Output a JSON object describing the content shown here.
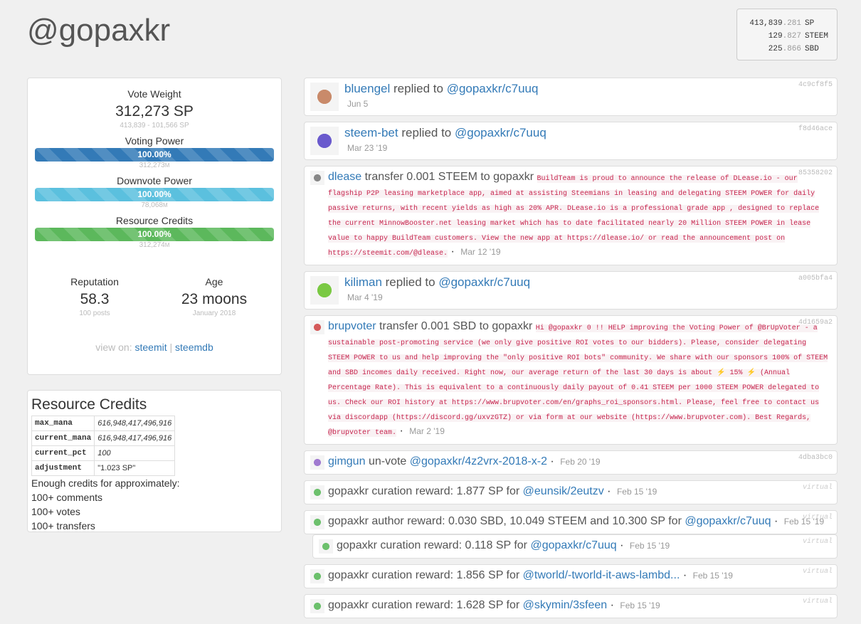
{
  "title": "@gopaxkr",
  "balances": [
    {
      "int": "413,839",
      "dec": ".281",
      "unit": "SP"
    },
    {
      "int": "129",
      "dec": ".827",
      "unit": "STEEM"
    },
    {
      "int": "225",
      "dec": ".866",
      "unit": "SBD"
    }
  ],
  "vote": {
    "label": "Vote Weight",
    "value": "312,273 SP",
    "range": "413,839 - 101,566 SP"
  },
  "bars": [
    {
      "label": "Voting Power",
      "pct": "100.00%",
      "value": 100,
      "sub": "312,273",
      "unit": "M",
      "color": "#337ab7"
    },
    {
      "label": "Downvote Power",
      "pct": "100.00%",
      "value": 100,
      "sub": "78,068",
      "unit": "M",
      "color": "#5bc0de"
    },
    {
      "label": "Resource Credits",
      "pct": "100.00%",
      "value": 100,
      "sub": "312,274",
      "unit": "M",
      "color": "#5cb85c"
    }
  ],
  "reputation": {
    "label": "Reputation",
    "value": "58.3",
    "sub": "100 posts"
  },
  "age": {
    "label": "Age",
    "value": "23 moons",
    "sub": "January 2018"
  },
  "view_on": {
    "label": "view on:",
    "links": [
      "steemit",
      "steemdb"
    ],
    "sep": "|"
  },
  "rc": {
    "title": "Resource Credits",
    "rows": [
      [
        "max_mana",
        "616,948,417,496,916"
      ],
      [
        "current_mana",
        "616,948,417,496,916"
      ],
      [
        "current_pct",
        "100"
      ],
      [
        "adjustment",
        "\"1.023 SP\""
      ]
    ],
    "enough": "Enough credits for approximately:",
    "lines": [
      "100+ comments",
      "100+ votes",
      "100+ transfers"
    ]
  },
  "feed": [
    {
      "user": "bluengel",
      "action": "replied to",
      "link": "@gopaxkr/c7uuq",
      "date": "Jun 5",
      "hash": "4c9cf8f5"
    },
    {
      "user": "steem-bet",
      "action": "replied to",
      "link": "@gopaxkr/c7uuq",
      "date": "Mar 23 '19",
      "hash": "f8d46ace"
    },
    {
      "user": "dlease",
      "action": "transfer 0.001 STEEM to gopaxkr",
      "memo": "BuildTeam is proud to announce the release of DLease.io - our flagship P2P leasing marketplace app, aimed at assisting Steemians in leasing and delegating STEEM POWER for daily passive returns, with recent yields as high as 20% APR. DLease.io is a professional grade app , designed to replace the current MinnowBooster.net leasing market which has to date facilitated nearly 20 Million STEEM POWER in lease value to happy BuildTeam customers. View the new app at https://dlease.io/ or read the announcement post on https://steemit.com/@dlease.",
      "date": "Mar 12 '19",
      "hash": "85358202"
    },
    {
      "user": "kiliman",
      "action": "replied to",
      "link": "@gopaxkr/c7uuq",
      "date": "Mar 4 '19",
      "hash": "a005bfa4"
    },
    {
      "user": "brupvoter",
      "action": "transfer 0.001 SBD to gopaxkr",
      "memo": "Hi @gopaxkr 0 !! HELP improving the Voting Power of @BrUpVoter - a sustainable post-promoting service (we only give positive ROI votes to our bidders). Please, consider delegating STEEM POWER to us and help improving the \"only positive ROI bots\" community. We share with our sponsors 100% of STEEM and SBD incomes daily received. Right now, our average return of the last 30 days is about ⚡ 15% ⚡ (Annual Percentage Rate). This is equivalent to a continuously daily payout of 0.41 STEEM per 1000 STEEM POWER delegated to us. Check our ROI history at https://www.brupvoter.com/en/graphs_roi_sponsors.html. Please, feel free to contact us via discordapp (https://discord.gg/uxvzGTZ) or via form at our website (https://www.brupvoter.com). Best Regards, @brupvoter team.",
      "date": "Mar 2 '19",
      "hash": "4d1659a2"
    },
    {
      "user": "gimgun",
      "action": "un-vote",
      "link": "@gopaxkr/4z2vrx-2018-x-2",
      "date": "Feb 20 '19",
      "hash": "4dba3bc0"
    },
    {
      "user": "gopaxkr",
      "action": "curation reward: 1.877 SP for",
      "link": "@eunsik/2eutzv",
      "date": "Feb 15 '19",
      "hash": "virtual"
    },
    {
      "user": "gopaxkr",
      "action": "author reward: 0.030 SBD, 10.049 STEEM and 10.300 SP for",
      "link": "@gopaxkr/c7uuq",
      "date": "Feb 15 '19",
      "hash": "virtual"
    },
    {
      "user": "gopaxkr",
      "action": "curation reward: 0.118 SP for",
      "link": "@gopaxkr/c7uuq",
      "date": "Feb 15 '19",
      "hash": "virtual",
      "indent": true
    },
    {
      "user": "gopaxkr",
      "action": "curation reward: 1.856 SP for",
      "link": "@tworld/-tworld-it-aws-lambd...",
      "date": "Feb 15 '19",
      "hash": "virtual"
    },
    {
      "user": "gopaxkr",
      "action": "curation reward: 1.628 SP for",
      "link": "@skymin/3sfeen",
      "date": "Feb 15 '19",
      "hash": "virtual"
    }
  ]
}
